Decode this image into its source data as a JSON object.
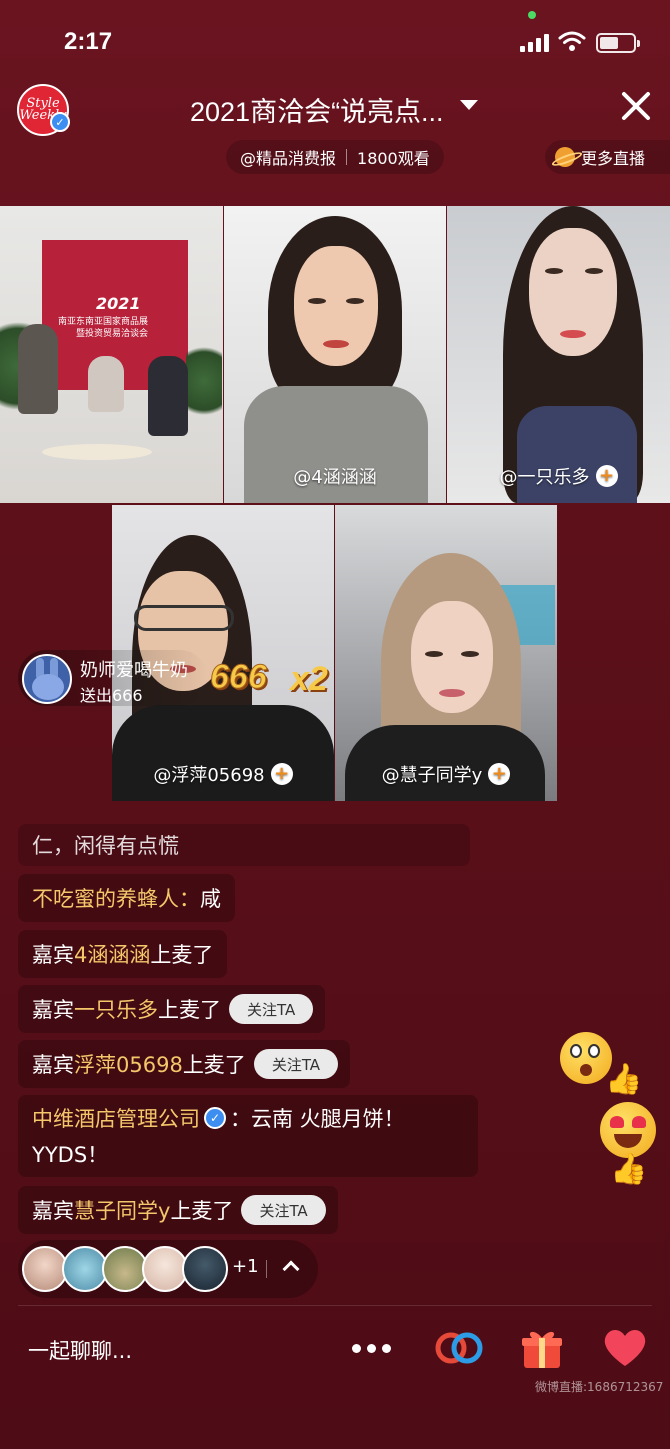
{
  "status_bar": {
    "time": "2:17"
  },
  "header": {
    "logo_text": "Style Weekly",
    "title": "2021商洽会“说亮点...",
    "host": "@精品消费报",
    "viewers": "1800观看",
    "more_live": "更多直播"
  },
  "stream": {
    "event_banner_year": "2021",
    "event_banner_line1": "南亚东南亚国家商品展",
    "event_banner_line2": "暨投资贸易洽谈会",
    "guests": [
      {
        "name": "@4涵涵涵"
      },
      {
        "name": "@一只乐多"
      },
      {
        "name": "@浮萍05698"
      },
      {
        "name": "@慧子同学y"
      }
    ]
  },
  "gift": {
    "user": "奶师爱喝牛奶",
    "text": "送出666",
    "gift_name": "666",
    "multiplier": "x2"
  },
  "comments": [
    {
      "parts": [
        {
          "t": "仁，闲得有点慌",
          "hl": false
        }
      ]
    },
    {
      "parts": [
        {
          "t": "不吃蜜的养蜂人：",
          "hl": true
        },
        {
          "t": "咸",
          "hl": false
        }
      ]
    },
    {
      "parts": [
        {
          "t": "嘉宾",
          "hl": false
        },
        {
          "t": "4涵涵涵",
          "hl": true
        },
        {
          "t": "上麦了",
          "hl": false
        }
      ]
    },
    {
      "parts": [
        {
          "t": "嘉宾",
          "hl": false
        },
        {
          "t": "一只乐多",
          "hl": true
        },
        {
          "t": "上麦了",
          "hl": false
        }
      ],
      "follow": "关注TA"
    },
    {
      "parts": [
        {
          "t": "嘉宾",
          "hl": false
        },
        {
          "t": "浮萍05698",
          "hl": true
        },
        {
          "t": "上麦了",
          "hl": false
        }
      ],
      "follow": "关注TA"
    },
    {
      "line1": [
        {
          "t": "中维酒店管理公司",
          "hl": true
        },
        {
          "t": "：云南 火腿月饼！",
          "hl": false
        }
      ],
      "line2": "YYDS！"
    },
    {
      "parts": [
        {
          "t": "嘉宾",
          "hl": false
        },
        {
          "t": "慧子同学y",
          "hl": true
        },
        {
          "t": "上麦了",
          "hl": false
        }
      ],
      "follow": "关注TA"
    }
  ],
  "viewers_row": {
    "extra": "+1"
  },
  "bottom": {
    "chat_placeholder": "一起聊聊...",
    "watermark": "微博直播:1686712367"
  },
  "colors": {
    "background": "#5c1019",
    "highlight": "#f5c76b",
    "plus_badge": "#f08a18",
    "verify": "#3c8ff0"
  }
}
